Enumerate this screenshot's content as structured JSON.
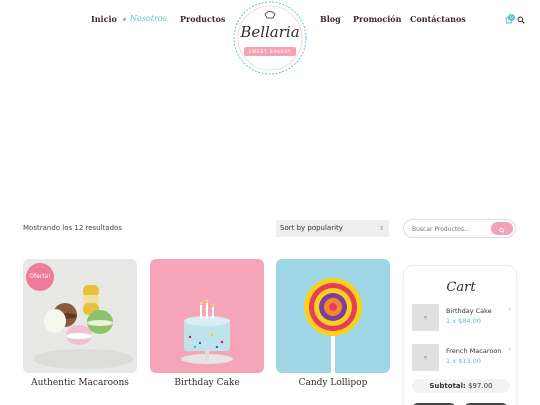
{
  "nav": {
    "items": [
      {
        "label": "Inicio"
      },
      {
        "label": "Nosotros"
      },
      {
        "label": "Productos"
      },
      {
        "label": "Blog"
      },
      {
        "label": "Promoción"
      },
      {
        "label": "Contáctanos"
      }
    ],
    "active_index": 1,
    "cart_count": "0"
  },
  "logo": {
    "text": "Bellaria",
    "ribbon": "SWEET BAKERY"
  },
  "toolbar": {
    "results_text": "Mostrando los 12 resultados",
    "sort_value": "Sort by popularity",
    "search_placeholder": "Buscar Productos..."
  },
  "products": [
    {
      "title": "Authentic Macaroons",
      "badge": "Oferta!"
    },
    {
      "title": "Birthday Cake"
    },
    {
      "title": "Candy Lollipop"
    }
  ],
  "cart": {
    "title": "Cart",
    "items": [
      {
        "name": "Birthday Cake",
        "qty": "1 x $84.00"
      },
      {
        "name": "French Macaroon",
        "qty": "1 x $13.00"
      }
    ],
    "subtotal_label": "Subtotal:",
    "subtotal_value": "$97.00"
  },
  "colors": {
    "accent": "#5ec4c9",
    "pink": "#f07a9a",
    "dark": "#3a2a2a"
  }
}
